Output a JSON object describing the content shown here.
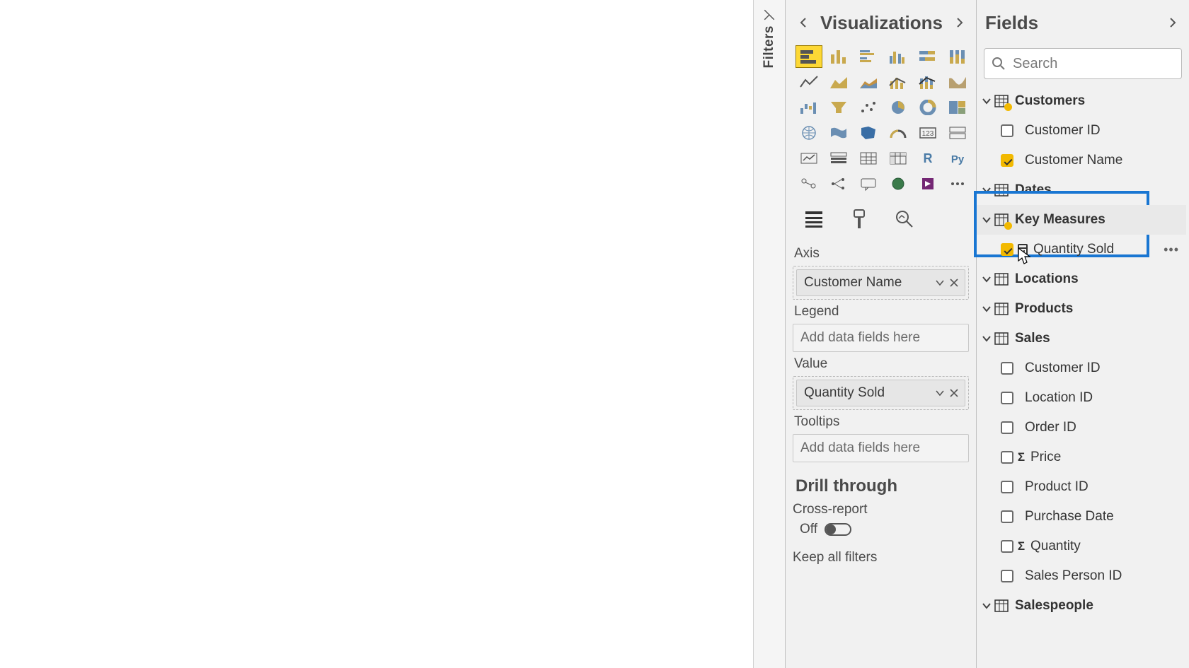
{
  "panes": {
    "filters": "Filters",
    "visualizations": {
      "title": "Visualizations"
    },
    "fields": {
      "title": "Fields",
      "searchPlaceholder": "Search"
    }
  },
  "wells": {
    "axis": {
      "label": "Axis",
      "field": "Customer Name"
    },
    "legend": {
      "label": "Legend",
      "placeholder": "Add data fields here"
    },
    "value": {
      "label": "Value",
      "field": "Quantity Sold"
    },
    "tooltips": {
      "label": "Tooltips",
      "placeholder": "Add data fields here"
    }
  },
  "drill": {
    "title": "Drill through",
    "crossReport": "Cross-report",
    "off": "Off",
    "keepAll": "Keep all filters"
  },
  "tables": {
    "customers": {
      "name": "Customers",
      "fields": {
        "customerId": "Customer ID",
        "customerName": "Customer Name"
      }
    },
    "dates": {
      "name": "Dates"
    },
    "keyMeasures": {
      "name": "Key Measures",
      "fields": {
        "quantitySold": "Quantity Sold"
      }
    },
    "locations": {
      "name": "Locations"
    },
    "products": {
      "name": "Products"
    },
    "sales": {
      "name": "Sales",
      "fields": {
        "customerId": "Customer ID",
        "locationId": "Location ID",
        "orderId": "Order ID",
        "price": "Price",
        "productId": "Product ID",
        "purchaseDate": "Purchase Date",
        "quantity": "Quantity",
        "salesPersonId": "Sales Person ID"
      }
    },
    "salespeople": {
      "name": "Salespeople"
    }
  }
}
